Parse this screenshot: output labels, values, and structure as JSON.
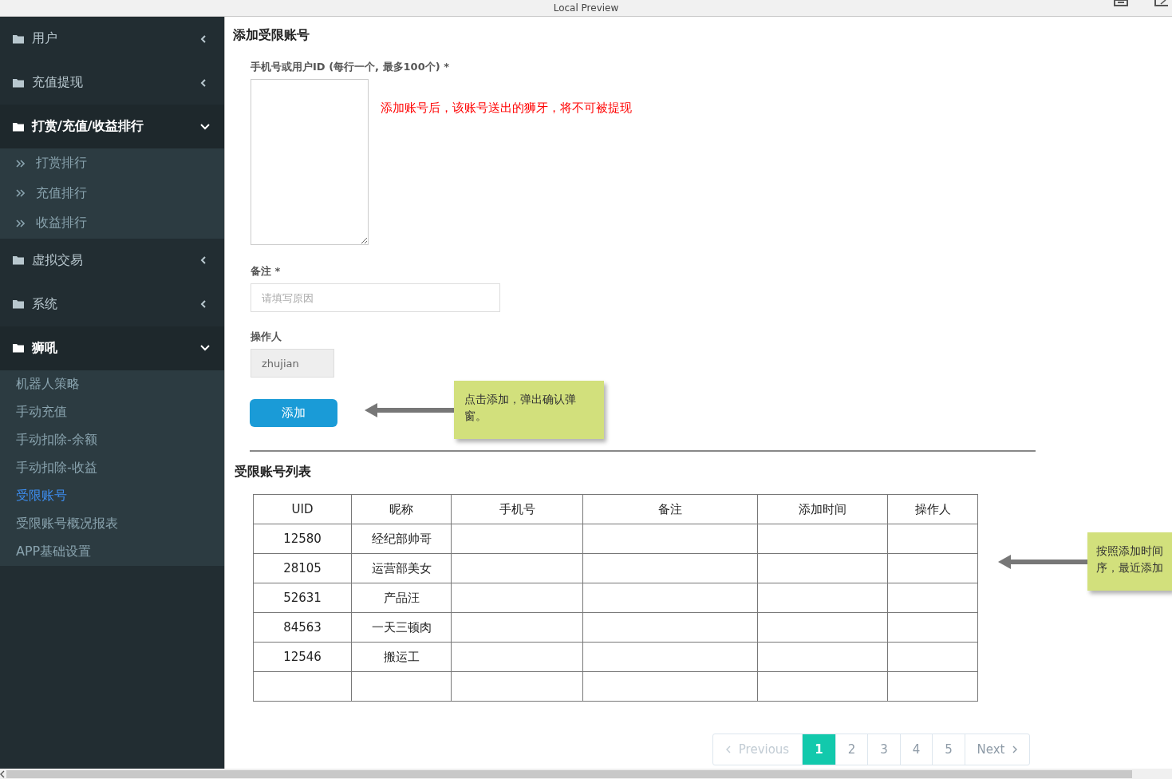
{
  "window": {
    "title": "Local Preview"
  },
  "sidebar": {
    "items": [
      {
        "label": "用户",
        "expanded": false
      },
      {
        "label": "充值提现",
        "expanded": false
      },
      {
        "label": "打赏/充值/收益排行",
        "expanded": true,
        "children": [
          {
            "label": "打赏排行",
            "kind": "arrow",
            "selected": false
          },
          {
            "label": "充值排行",
            "kind": "arrow",
            "selected": false
          },
          {
            "label": "收益排行",
            "kind": "arrow",
            "selected": false
          }
        ]
      },
      {
        "label": "虚拟交易",
        "expanded": false
      },
      {
        "label": "系统",
        "expanded": false
      },
      {
        "label": "狮吼",
        "expanded": true,
        "children": [
          {
            "label": "机器人策略",
            "kind": "plain",
            "selected": false
          },
          {
            "label": "手动充值",
            "kind": "plain",
            "selected": false
          },
          {
            "label": "手动扣除-余额",
            "kind": "plain",
            "selected": false
          },
          {
            "label": "手动扣除-收益",
            "kind": "plain",
            "selected": false
          },
          {
            "label": "受限账号",
            "kind": "plain",
            "selected": true
          },
          {
            "label": "受限账号概况报表",
            "kind": "plain",
            "selected": false
          },
          {
            "label": "APP基础设置",
            "kind": "plain",
            "selected": false
          }
        ]
      }
    ]
  },
  "form": {
    "title": "添加受限账号",
    "ids_label": "手机号或用户ID (每行一个, 最多100个) *",
    "hint": "添加账号后，该账号送出的狮牙，将不可被提现",
    "note_label": "备注 *",
    "note_placeholder": "请填写原因",
    "operator_label": "操作人",
    "operator_value": "zhujian",
    "operator_disabled": true,
    "submit": "添加",
    "annotation": "点击添加，弹出确认弹窗。"
  },
  "list": {
    "title": "受限账号列表",
    "columns": [
      "UID",
      "昵称",
      "手机号",
      "备注",
      "添加时间",
      "操作人"
    ],
    "rows": [
      {
        "uid": "12580",
        "nickname": "经纪部帅哥"
      },
      {
        "uid": "28105",
        "nickname": "运营部美女"
      },
      {
        "uid": "52631",
        "nickname": "产品汪"
      },
      {
        "uid": "84563",
        "nickname": "一天三顿肉"
      },
      {
        "uid": "12546",
        "nickname": "搬运工"
      }
    ],
    "annotation": "按照添加时间序，最近添加"
  },
  "pagination": {
    "previous": {
      "label": "Previous",
      "disabled": true
    },
    "pages": [
      {
        "label": "1",
        "selected": true
      },
      {
        "label": "2",
        "selected": false
      },
      {
        "label": "3",
        "selected": false
      },
      {
        "label": "4",
        "selected": false
      },
      {
        "label": "5",
        "selected": false
      }
    ],
    "next": {
      "label": "Next",
      "disabled": false
    }
  }
}
